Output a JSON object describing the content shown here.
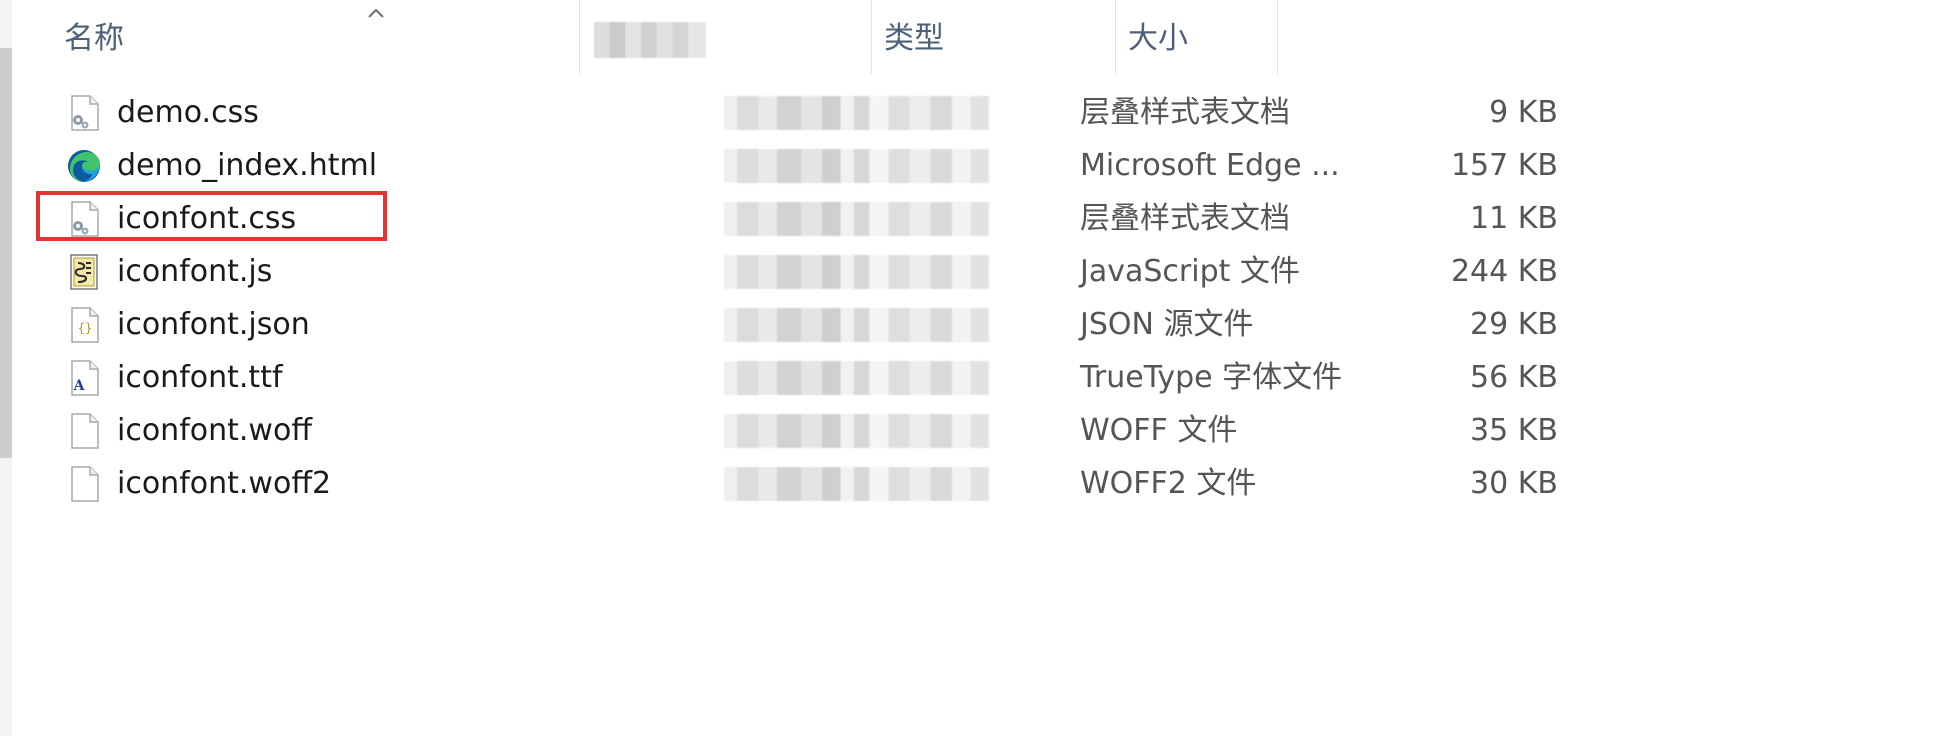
{
  "header": {
    "columns": [
      {
        "key": "name",
        "label": "名称"
      },
      {
        "key": "date",
        "label": ""
      },
      {
        "key": "type",
        "label": "类型"
      },
      {
        "key": "size",
        "label": "大小"
      }
    ],
    "sort": {
      "column": "name",
      "direction": "ascending"
    }
  },
  "files": [
    {
      "name": "demo.css",
      "type": "层叠样式表文档",
      "size": "9 KB",
      "icon": "css-file-icon"
    },
    {
      "name": "demo_index.html",
      "type": "Microsoft Edge ...",
      "size": "157 KB",
      "icon": "edge-html-icon"
    },
    {
      "name": "iconfont.css",
      "type": "层叠样式表文档",
      "size": "11 KB",
      "icon": "css-file-icon",
      "highlighted": true
    },
    {
      "name": "iconfont.js",
      "type": "JavaScript 文件",
      "size": "244 KB",
      "icon": "js-file-icon"
    },
    {
      "name": "iconfont.json",
      "type": "JSON 源文件",
      "size": "29 KB",
      "icon": "json-file-icon"
    },
    {
      "name": "iconfont.ttf",
      "type": "TrueType 字体文件",
      "size": "56 KB",
      "icon": "font-file-icon"
    },
    {
      "name": "iconfont.woff",
      "type": "WOFF 文件",
      "size": "35 KB",
      "icon": "blank-file-icon"
    },
    {
      "name": "iconfont.woff2",
      "type": "WOFF2 文件",
      "size": "30 KB",
      "icon": "blank-file-icon"
    }
  ],
  "colors": {
    "header_text": "#4c607a",
    "highlight_border": "#e53333",
    "edge_blue": "#0c59a4",
    "edge_green": "#41c46c"
  }
}
